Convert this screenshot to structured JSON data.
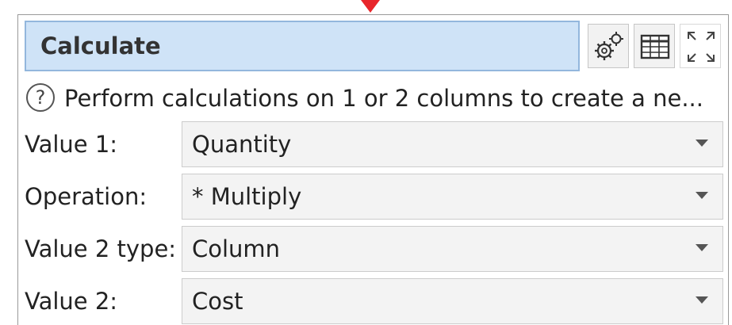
{
  "title": "Calculate",
  "toolbar": {
    "icons": [
      "gears-icon",
      "table-icon",
      "expand-icon"
    ]
  },
  "help": {
    "icon": "?",
    "text": "Perform calculations on 1 or 2 columns to create a ne..."
  },
  "fields": [
    {
      "label": "Value 1:",
      "value": "Quantity"
    },
    {
      "label": "Operation:",
      "value": "* Multiply"
    },
    {
      "label": "Value 2 type:",
      "value": "Column"
    },
    {
      "label": "Value 2:",
      "value": "Cost"
    }
  ],
  "colors": {
    "title_bg": "#cfe3f7",
    "title_border": "#93b7dd",
    "select_bg": "#f3f3f3",
    "pointer": "#e8262b"
  }
}
